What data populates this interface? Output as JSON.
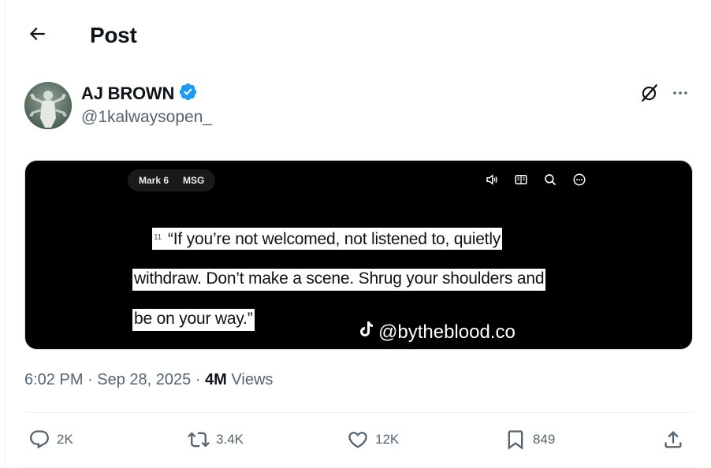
{
  "header": {
    "title": "Post",
    "back_icon": "arrow-left-icon"
  },
  "author": {
    "display_name": "AJ BROWN",
    "handle": "@1kalwaysopen_",
    "verified": true,
    "verified_color": "#1d9bf0",
    "avatar_icon": "avatar-image"
  },
  "media": {
    "pill": {
      "left": "Mark 6",
      "right": "MSG"
    },
    "top_icons": [
      "speaker-icon",
      "book-icon",
      "search-icon",
      "more-circle-icon"
    ],
    "caption": {
      "verse_number": "11",
      "line1": "“If you’re not welcomed, not listened to, quietly",
      "line2": "withdraw. Don’t make a scene. Shrug your shoulders and",
      "line3": "be on your way.”"
    },
    "watermark": "@bytheblood.co"
  },
  "meta": {
    "time": "6:02 PM",
    "date": "Sep 28, 2025",
    "views_count": "4M",
    "views_label": "Views"
  },
  "actions": {
    "replies": "2K",
    "reposts": "3.4K",
    "likes": "12K",
    "bookmarks": "849"
  }
}
